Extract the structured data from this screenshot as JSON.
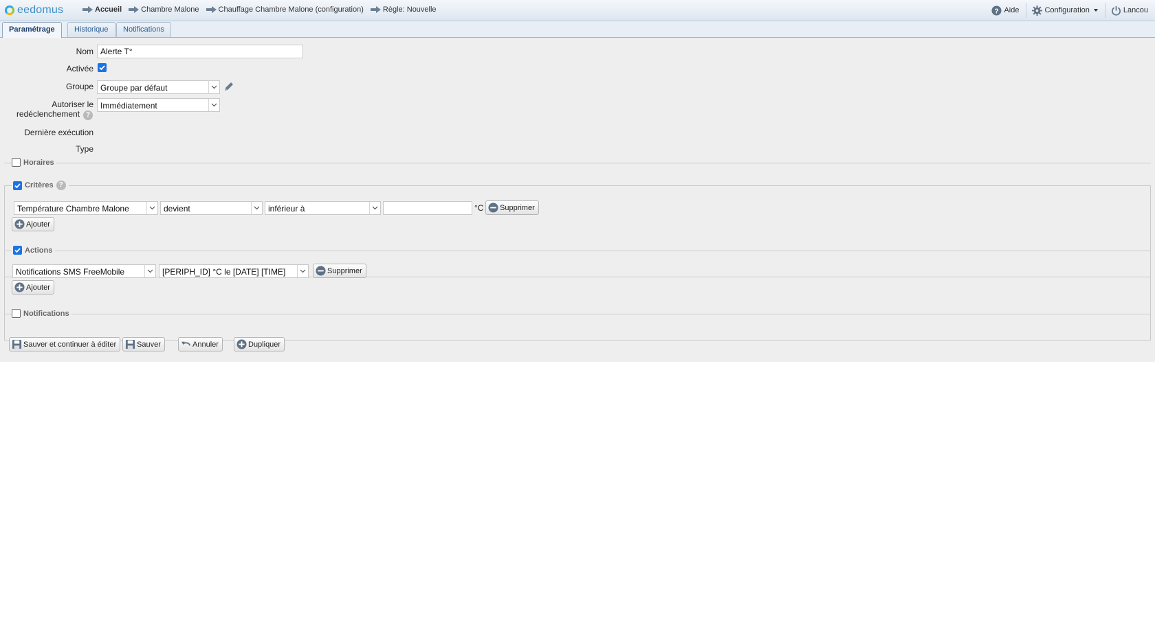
{
  "header": {
    "logo_text": "eedomus",
    "breadcrumb": [
      "Accueil",
      "Chambre Malone",
      "Chauffage Chambre Malone (configuration)",
      "Règle: Nouvelle"
    ],
    "help_label": "Aide",
    "config_label": "Configuration",
    "user_label": "Lancou"
  },
  "tabs": [
    "Paramétrage",
    "Historique",
    "Notifications"
  ],
  "form": {
    "name_label": "Nom",
    "name_value": "Alerte T°",
    "active_label": "Activée",
    "active_checked": true,
    "group_label": "Groupe",
    "group_value": "Groupe par défaut",
    "retrigger_label_1": "Autoriser le",
    "retrigger_label_2": "redéclenchement",
    "retrigger_value": "Immédiatement",
    "last_exec_label": "Dernière exécution",
    "type_label": "Type"
  },
  "sections": {
    "horaires": {
      "title": "Horaires",
      "checked": false
    },
    "criteres": {
      "title": "Critères",
      "checked": true,
      "row": {
        "device": "Température Chambre Malone",
        "operator": "devient",
        "comparison": "inférieur à",
        "value": "",
        "unit": "°C",
        "delete_label": "Supprimer"
      },
      "add_label": "Ajouter"
    },
    "actions": {
      "title": "Actions",
      "checked": true,
      "row": {
        "device": "Notifications SMS FreeMobile",
        "message": "[PERIPH_ID] °C le [DATE] [TIME]",
        "delete_label": "Supprimer"
      },
      "add_label": "Ajouter"
    },
    "notifications": {
      "title": "Notifications",
      "checked": false
    }
  },
  "footer": {
    "save_continue_label": "Sauver et continuer à éditer",
    "save_label": "Sauver",
    "cancel_label": "Annuler",
    "duplicate_label": "Dupliquer"
  },
  "colors": {
    "accent": "#1a73e8",
    "tab_text": "#2a5b8e",
    "panel_bg": "#eeeeee"
  }
}
